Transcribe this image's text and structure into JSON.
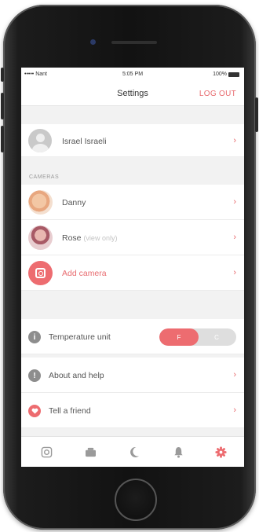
{
  "status": {
    "carrier": "••••• Nant",
    "time": "5:05 PM",
    "battery": "100%"
  },
  "nav": {
    "title": "Settings",
    "logout": "LOG OUT"
  },
  "profile": {
    "name": "Israel Israeli"
  },
  "cameras": {
    "section_title": "CAMERAS",
    "items": [
      {
        "name": "Danny",
        "note": ""
      },
      {
        "name": "Rose",
        "note": "(view only)"
      }
    ],
    "add_label": "Add camera"
  },
  "settings": {
    "temperature": {
      "label": "Temperature unit",
      "options": [
        "F",
        "C"
      ],
      "selected": "F"
    },
    "about": {
      "label": "About and help"
    },
    "tell": {
      "label": "Tell a friend"
    }
  },
  "tabs": [
    {
      "icon": "camera-icon",
      "active": false
    },
    {
      "icon": "video-icon",
      "active": false
    },
    {
      "icon": "moon-icon",
      "active": false
    },
    {
      "icon": "bell-icon",
      "active": false
    },
    {
      "icon": "gear-icon",
      "active": true
    }
  ],
  "colors": {
    "accent": "#ed6c70",
    "icon_inactive": "#9a9a9a"
  }
}
